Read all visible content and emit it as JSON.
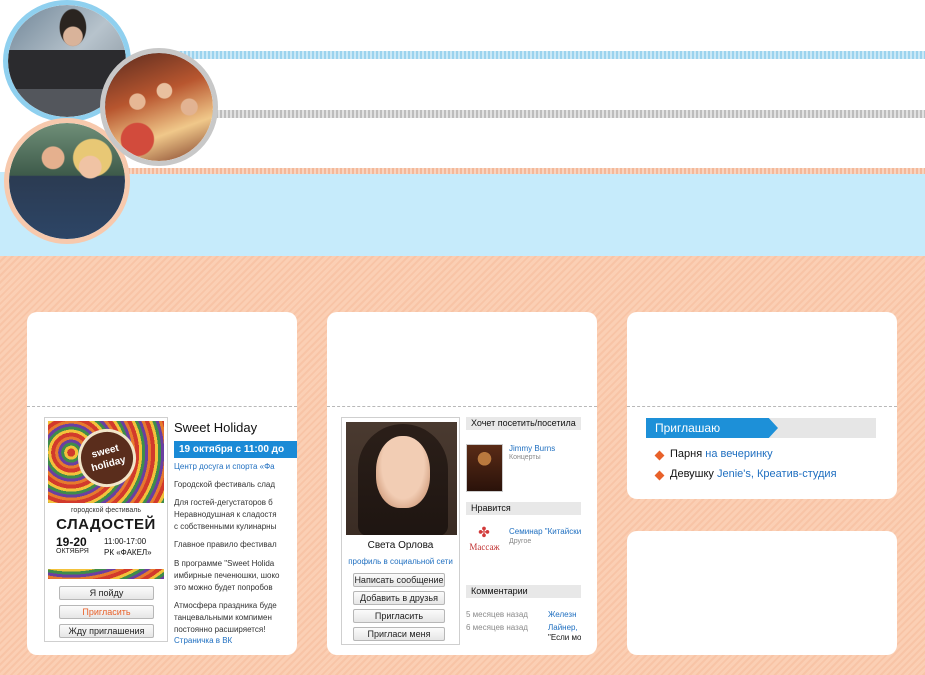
{
  "event": {
    "poster": {
      "logo": "sweet holiday",
      "subtitle": "городской фестиваль",
      "title": "СЛАДОСТЕЙ",
      "date": "19-20",
      "month": "ОКТЯБРЯ",
      "time": "11:00-17:00",
      "place": "РК «ФАКЕЛ»"
    },
    "buttons": {
      "go": "Я пойду",
      "invite": "Пригласить",
      "wait": "Жду приглашения"
    },
    "title": "Sweet Holiday",
    "date": "19 октября с 11:00 до",
    "place": "Центр досуга и спорта «Фа",
    "desc": [
      "Городской фестиваль слад",
      "Для гостей-дегустаторов б",
      "Неравнодушная к сладостя",
      "с собственными кулинарны",
      "Главное правило фестивал",
      "В программе \"Sweet Holida",
      "имбирные печенюшки, шоко",
      "это можно будет попробов",
      "Атмосфера праздника буде",
      "танцевальными компимен",
      "постоянно расширяется!"
    ],
    "link": "Страничка в ВК"
  },
  "profile": {
    "name": "Света Орлова",
    "link": "профиль в социальной сети",
    "buttons": [
      "Написать сообщение",
      "Добавить в друзья",
      "Пригласить",
      "Пригласи меня"
    ],
    "want_header": "Хочет посетить/посетила",
    "want_item": {
      "name": "Jimmy Burns",
      "category": "Концерты"
    },
    "likes_header": "Нравится",
    "likes_item": {
      "name": "Семинар \"Китайский",
      "category": "Другое",
      "logo": "Массаж"
    },
    "comments_header": "Комментарии",
    "comments": [
      {
        "time": "5 месяцев назад",
        "name": "Железн",
        "text": ""
      },
      {
        "time": "6 месяцев назад",
        "name": "Лайнер,",
        "text": "\"Если мо"
      }
    ]
  },
  "invite": {
    "header": "Приглашаю",
    "rows": [
      {
        "who": "Парня",
        "what": "на вечеринку"
      },
      {
        "who": "Девушку",
        "what": "Jenie's, Креатив-студия"
      }
    ]
  }
}
